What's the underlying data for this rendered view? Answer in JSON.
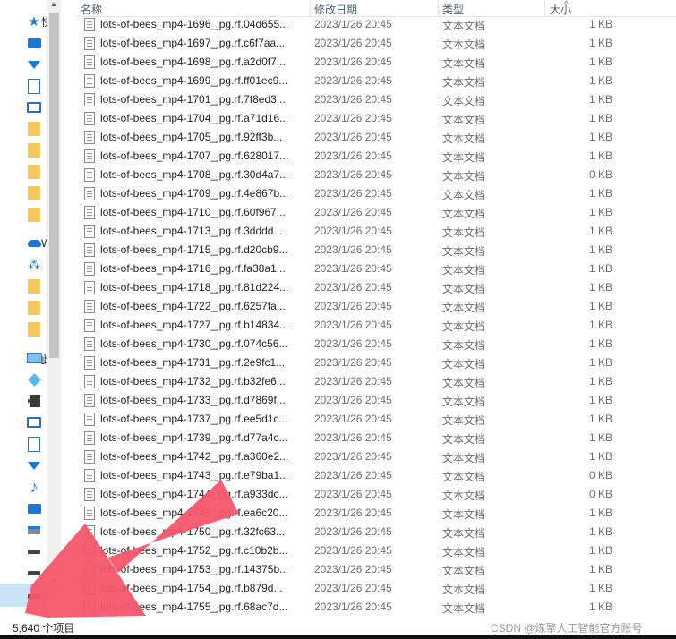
{
  "header": {
    "name": "名称",
    "date": "修改日期",
    "type": "类型",
    "size": "大小"
  },
  "nav": {
    "quick_access_label": "快",
    "onedrive_label": "W",
    "this_pc_label": "此"
  },
  "files": [
    {
      "name": "lots-of-bees_mp4-1696_jpg.rf.04d655...",
      "date": "2023/1/26 20:45",
      "type": "文本文档",
      "size": "1 KB"
    },
    {
      "name": "lots-of-bees_mp4-1697_jpg.rf.c6f7aa...",
      "date": "2023/1/26 20:45",
      "type": "文本文档",
      "size": "1 KB"
    },
    {
      "name": "lots-of-bees_mp4-1698_jpg.rf.a2d0f7...",
      "date": "2023/1/26 20:45",
      "type": "文本文档",
      "size": "1 KB"
    },
    {
      "name": "lots-of-bees_mp4-1699_jpg.rf.ff01ec9...",
      "date": "2023/1/26 20:45",
      "type": "文本文档",
      "size": "1 KB"
    },
    {
      "name": "lots-of-bees_mp4-1701_jpg.rf.7f8ed3...",
      "date": "2023/1/26 20:45",
      "type": "文本文档",
      "size": "1 KB"
    },
    {
      "name": "lots-of-bees_mp4-1704_jpg.rf.a71d16...",
      "date": "2023/1/26 20:45",
      "type": "文本文档",
      "size": "1 KB"
    },
    {
      "name": "lots-of-bees_mp4-1705_jpg.rf.92ff3b...",
      "date": "2023/1/26 20:45",
      "type": "文本文档",
      "size": "1 KB"
    },
    {
      "name": "lots-of-bees_mp4-1707_jpg.rf.628017...",
      "date": "2023/1/26 20:45",
      "type": "文本文档",
      "size": "1 KB"
    },
    {
      "name": "lots-of-bees_mp4-1708_jpg.rf.30d4a7...",
      "date": "2023/1/26 20:45",
      "type": "文本文档",
      "size": "0 KB"
    },
    {
      "name": "lots-of-bees_mp4-1709_jpg.rf.4e867b...",
      "date": "2023/1/26 20:45",
      "type": "文本文档",
      "size": "1 KB"
    },
    {
      "name": "lots-of-bees_mp4-1710_jpg.rf.60f967...",
      "date": "2023/1/26 20:45",
      "type": "文本文档",
      "size": "1 KB"
    },
    {
      "name": "lots-of-bees_mp4-1713_jpg.rf.3dddd...",
      "date": "2023/1/26 20:45",
      "type": "文本文档",
      "size": "1 KB"
    },
    {
      "name": "lots-of-bees_mp4-1715_jpg.rf.d20cb9...",
      "date": "2023/1/26 20:45",
      "type": "文本文档",
      "size": "1 KB"
    },
    {
      "name": "lots-of-bees_mp4-1716_jpg.rf.fa38a1...",
      "date": "2023/1/26 20:45",
      "type": "文本文档",
      "size": "1 KB"
    },
    {
      "name": "lots-of-bees_mp4-1718_jpg.rf.81d224...",
      "date": "2023/1/26 20:45",
      "type": "文本文档",
      "size": "1 KB"
    },
    {
      "name": "lots-of-bees_mp4-1722_jpg.rf.6257fa...",
      "date": "2023/1/26 20:45",
      "type": "文本文档",
      "size": "1 KB"
    },
    {
      "name": "lots-of-bees_mp4-1727_jpg.rf.b14834...",
      "date": "2023/1/26 20:45",
      "type": "文本文档",
      "size": "1 KB"
    },
    {
      "name": "lots-of-bees_mp4-1730_jpg.rf.074c56...",
      "date": "2023/1/26 20:45",
      "type": "文本文档",
      "size": "1 KB"
    },
    {
      "name": "lots-of-bees_mp4-1731_jpg.rf.2e9fc1...",
      "date": "2023/1/26 20:45",
      "type": "文本文档",
      "size": "1 KB"
    },
    {
      "name": "lots-of-bees_mp4-1732_jpg.rf.b32fe6...",
      "date": "2023/1/26 20:45",
      "type": "文本文档",
      "size": "1 KB"
    },
    {
      "name": "lots-of-bees_mp4-1733_jpg.rf.d7869f...",
      "date": "2023/1/26 20:45",
      "type": "文本文档",
      "size": "1 KB"
    },
    {
      "name": "lots-of-bees_mp4-1737_jpg.rf.ee5d1c...",
      "date": "2023/1/26 20:45",
      "type": "文本文档",
      "size": "1 KB"
    },
    {
      "name": "lots-of-bees_mp4-1739_jpg.rf.d77a4c...",
      "date": "2023/1/26 20:45",
      "type": "文本文档",
      "size": "1 KB"
    },
    {
      "name": "lots-of-bees_mp4-1742_jpg.rf.a360e2...",
      "date": "2023/1/26 20:45",
      "type": "文本文档",
      "size": "1 KB"
    },
    {
      "name": "lots-of-bees_mp4-1743_jpg.rf.e79ba1...",
      "date": "2023/1/26 20:45",
      "type": "文本文档",
      "size": "0 KB"
    },
    {
      "name": "lots-of-bees_mp4-1744_jpg.rf.a933dc...",
      "date": "2023/1/26 20:45",
      "type": "文本文档",
      "size": "0 KB"
    },
    {
      "name": "lots-of-bees_mp4-1749_jpg.rf.ea6c20...",
      "date": "2023/1/26 20:45",
      "type": "文本文档",
      "size": "1 KB"
    },
    {
      "name": "lots-of-bees_mp4-1750_jpg.rf.32fc63...",
      "date": "2023/1/26 20:45",
      "type": "文本文档",
      "size": "1 KB"
    },
    {
      "name": "lots-of-bees_mp4-1752_jpg.rf.c10b2b...",
      "date": "2023/1/26 20:45",
      "type": "文本文档",
      "size": "1 KB"
    },
    {
      "name": "lots-of-bees_mp4-1753_jpg.rf.14375b...",
      "date": "2023/1/26 20:45",
      "type": "文本文档",
      "size": "1 KB"
    },
    {
      "name": "lots-of-bees_mp4-1754_jpg.rf.b879d...",
      "date": "2023/1/26 20:45",
      "type": "文本文档",
      "size": "1 KB"
    },
    {
      "name": "lots-of-bees_mp4-1755_jpg.rf.68ac7d...",
      "date": "2023/1/26 20:45",
      "type": "文本文档",
      "size": "1 KB"
    }
  ],
  "status": {
    "item_count": "5,640 个项目"
  },
  "watermark": "CSDN @炼擎人工智能官方账号",
  "colors": {
    "accent": "#1b78d0",
    "folder": "#f5c85d",
    "arrow": "#f4566b",
    "selection": "#cce4f7"
  },
  "icons": {
    "nav": [
      "star-icon",
      "desktop-icon",
      "download-icon",
      "document-icon",
      "picture-icon",
      "folder-icon",
      "cloud-icon",
      "network-icon",
      "pc-icon",
      "3d-object-icon",
      "video-icon",
      "music-icon",
      "drive-icon"
    ],
    "file": "text-file-icon",
    "overlay": "pointing-arrow-icon"
  }
}
